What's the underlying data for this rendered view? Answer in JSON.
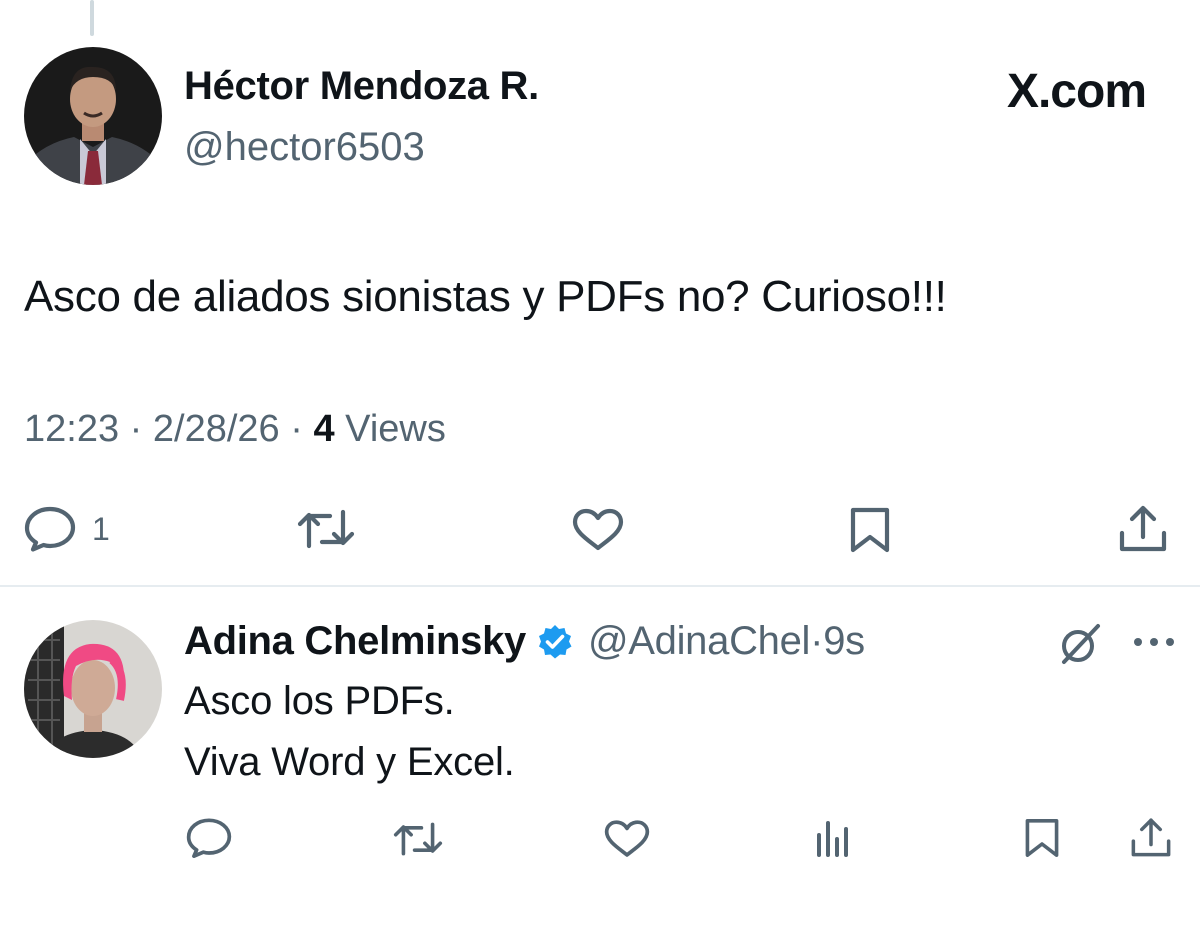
{
  "main_tweet": {
    "author_name": "Héctor Mendoza R.",
    "author_handle": "@hector6503",
    "brand": "X.com",
    "text": "Asco de aliados sionistas y PDFs no? Curioso!!!",
    "time": "12:23",
    "separator": " · ",
    "date": "2/28/26",
    "views_count": "4",
    "views_label": "Views",
    "actions": {
      "reply_icon": "reply-icon",
      "reply_count": "1",
      "retweet_icon": "retweet-icon",
      "like_icon": "heart-icon",
      "bookmark_icon": "bookmark-icon",
      "share_icon": "share-icon"
    }
  },
  "reply": {
    "author_name": "Adina Chelminsky",
    "verified": true,
    "author_handle": "@AdinaChel",
    "separator": " · ",
    "time": "9s",
    "text_lines": [
      "Asco los PDFs.",
      "Viva Word y Excel."
    ],
    "actions": {
      "reply_icon": "reply-icon",
      "retweet_icon": "retweet-icon",
      "like_icon": "heart-icon",
      "views_icon": "analytics-icon",
      "bookmark_icon": "bookmark-icon",
      "share_icon": "share-icon"
    }
  },
  "colors": {
    "text_primary": "#0f1419",
    "text_secondary": "#536471",
    "verified_blue": "#1d9bf0",
    "divider": "#e6ecf0",
    "thread_line": "#cfd9de"
  }
}
